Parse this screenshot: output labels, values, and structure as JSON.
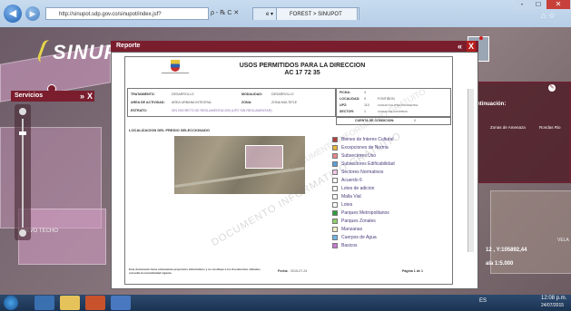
{
  "browser": {
    "address": "http://sinupot.sdp.gov.co/sinupot/index.jsf?",
    "address_tools": "ρ ‑ ℞ C ✕",
    "tab1_label": "e ▾",
    "tab2_label": "FOREST > SINUPOT",
    "win_min": "‑",
    "win_max": "□",
    "win_close": "✕"
  },
  "app": {
    "logo": "SINUPC"
  },
  "servicios": {
    "title": "Servicios",
    "collapse": "»",
    "close": "X"
  },
  "report": {
    "title": "Reporte",
    "collapse": "«",
    "close": "X",
    "doc_title": "USOS PERMITIDOS PARA LA DIRECCION",
    "doc_address": "AC 17 72 35",
    "fields": {
      "tratamiento_label": "TRATAMIENTO:",
      "tratamiento_value": "DESARROLLO",
      "modalidad_label": "MODALIDAD:",
      "modalidad_value": "DESARROLLO",
      "area_label": "AREA DE ACTIVIDAD:",
      "area_value": "AREA URBANA INTEGRAL",
      "zona_label": "ZONA:",
      "zona_value": "ZONA MULTIPLE",
      "estrato_label": "ESTRATO:",
      "estrato_value": "SIN DECRETO DE REGLAMENTACION (UPZ SIN REGLAMENTAR)",
      "ficha_label": "FICHA:",
      "ficha_value": "4",
      "localidad_label": "LOCALIDAD:",
      "localidad_value": "9",
      "localidad_name": "FONTIBON",
      "upz_label": "UPZ:",
      "upz_value": "110",
      "upz_name": "CIUDAD SALITRE OCCIDENTAL",
      "sector_label": "SECTOR:",
      "sector_value": "1",
      "sector_name": "CIUDAD DE FONTIBON",
      "cuenta_label": "CUENTA DE CONDICION:",
      "cuenta_value": "0",
      "plano_label": "LOCALIZACION DEL PREDIO SELECCIONADO",
      "footer_text": "Este documento tiene unicamente propósitos informativos y no sustituye a los documentos oficiales; consulte la normatividad vigente.",
      "fecha_label": "Fecha:",
      "fecha_value": "2015-07-24",
      "pagina_label": "Página 1 de 1"
    },
    "watermark": "DOCUMENTO INFORMATIVO GRATUITO",
    "legend": [
      {
        "label": "Bienes de Interes Cultural",
        "color": "#b0413e"
      },
      {
        "label": "Excepciones de Norma",
        "color": "#e8b53c"
      },
      {
        "label": "Subsectores Uso",
        "color": "#e88a8a"
      },
      {
        "label": "Subsectores Edificabilidad",
        "color": "#5aa0d8"
      },
      {
        "label": "Sectores Normativos",
        "color": "#f3c6e6"
      },
      {
        "label": "Acuerdo 6",
        "color": "#ffffff"
      },
      {
        "label": "Lotes de adicion",
        "color": "#ffffff"
      },
      {
        "label": "Malla Vial",
        "color": "#ffffff"
      },
      {
        "label": "Lotes",
        "color": "#ffffff"
      },
      {
        "label": "Parques Metropolitanos",
        "color": "#2f9e3a"
      },
      {
        "label": "Parques Zonales",
        "color": "#8fd16a"
      },
      {
        "label": "Manzanas",
        "color": "#f5f0c8"
      },
      {
        "label": "Cuerpos de Agua",
        "color": "#6fb6e8"
      },
      {
        "label": "Basicos",
        "color": "#c87ad1"
      }
    ]
  },
  "right_panel": {
    "continuacion": "continuación:",
    "col1": "Zonas de Amenaza",
    "col2": "Rondas Rio",
    "coords": "12 , Y:105892,44",
    "scale": "ala 1:5.000",
    "vel": "VELA"
  },
  "map_labels": {
    "nuevo": "NUEVO TECHO",
    "pdf": "PDF"
  },
  "taskbar": {
    "time": "12:08 p.m.",
    "date": "24/07/2015",
    "lang": "ES"
  }
}
